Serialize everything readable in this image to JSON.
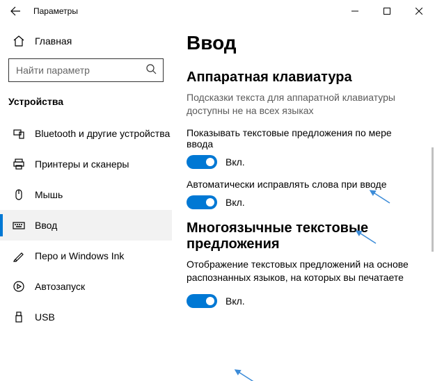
{
  "window": {
    "title": "Параметры"
  },
  "sidebar": {
    "home_label": "Главная",
    "search_placeholder": "Найти параметр",
    "section_title": "Устройства",
    "items": [
      {
        "label": "Bluetooth и другие устройства"
      },
      {
        "label": "Принтеры и сканеры"
      },
      {
        "label": "Мышь"
      },
      {
        "label": "Ввод"
      },
      {
        "label": "Перо и Windows Ink"
      },
      {
        "label": "Автозапуск"
      },
      {
        "label": "USB"
      }
    ]
  },
  "main": {
    "title": "Ввод",
    "section1_title": "Аппаратная клавиатура",
    "section1_desc": "Подсказки текста для аппаратной клавиатуры доступны не на всех языках",
    "setting1_label": "Показывать текстовые предложения по мере ввода",
    "setting2_label": "Автоматически исправлять слова при вводе",
    "section2_title": "Многоязычные текстовые предложения",
    "section2_desc": "Отображение текстовых предложений на основе распознанных языков, на которых вы печатаете",
    "toggle_on": "Вкл."
  }
}
